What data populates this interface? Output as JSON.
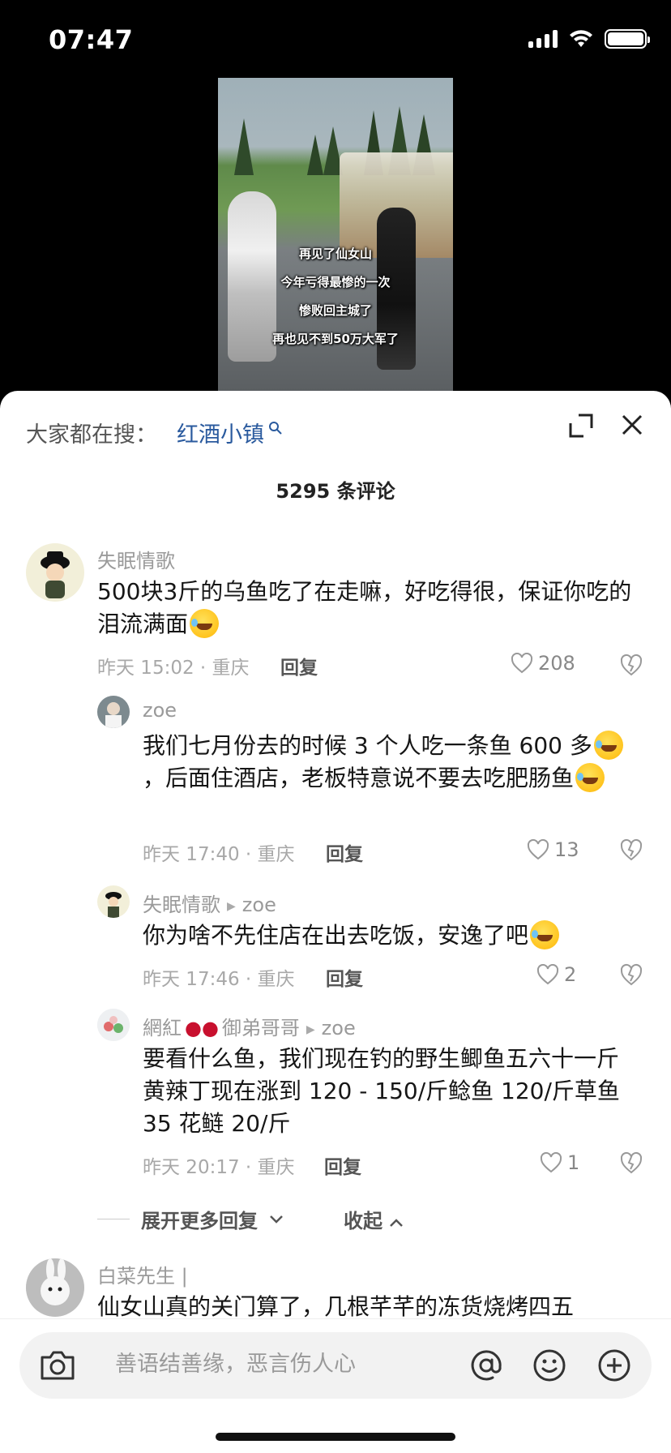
{
  "status_bar": {
    "time": "07:47"
  },
  "video": {
    "caption_lines": [
      "再见了仙女山",
      "今年亏得最惨的一次",
      "惨败回主城了",
      "再也见不到50万大军了"
    ]
  },
  "sheet": {
    "search_hint": "大家都在搜：",
    "search_keyword": "红酒小镇",
    "comment_count": "5295 条评论"
  },
  "comments": [
    {
      "name": "失眠情歌",
      "text": "500块3斤的乌鱼吃了在走嘛，好吃得很，保证你吃的泪流满面",
      "time": "昨天 15:02 · 重庆",
      "reply_label": "回复",
      "likes": "208"
    },
    {
      "name": "zoe",
      "text_a": "我们七月份去的时候 3 个人吃一条鱼 600 多",
      "text_b": "，后面住酒店，老板特意说不要去吃肥肠",
      "text_c": "鱼",
      "time": "昨天 17:40 · 重庆",
      "reply_label": "回复",
      "likes": "13"
    },
    {
      "name": "失眠情歌",
      "reply_to": "zoe",
      "text": "你为啥不先住店在出去吃饭，安逸了吧",
      "time": "昨天 17:46 · 重庆",
      "reply_label": "回复",
      "likes": "2"
    },
    {
      "name_a": "網紅",
      "name_b": "御弟哥哥",
      "reply_to": "zoe",
      "text": "要看什么鱼，我们现在钓的野生鲫鱼五六十一斤黄辣丁现在涨到 120 - 150/斤鲶鱼 120/斤草鱼 35 花鲢 20/斤",
      "time": "昨天 20:17 · 重庆",
      "reply_label": "回复",
      "likes": "1"
    },
    {
      "name": "白菜先生 |",
      "text": "仙女山真的关门算了，几根芊芊的冻货烧烤四五"
    }
  ],
  "thread_controls": {
    "expand_more": "展开更多回复",
    "collapse": "收起"
  },
  "input": {
    "placeholder": "善语结善缘，恶言伤人心"
  },
  "icons": {
    "camera": "camera-icon",
    "at": "at-icon",
    "emoji": "emoji-icon",
    "add": "plus-icon",
    "close": "close-icon",
    "expand": "expand-icon",
    "heart": "heart-icon",
    "dislike": "broken-heart-icon"
  },
  "colors": {
    "keyword": "#2a5a9e",
    "meta": "#a8a8a8",
    "text": "#161616"
  }
}
